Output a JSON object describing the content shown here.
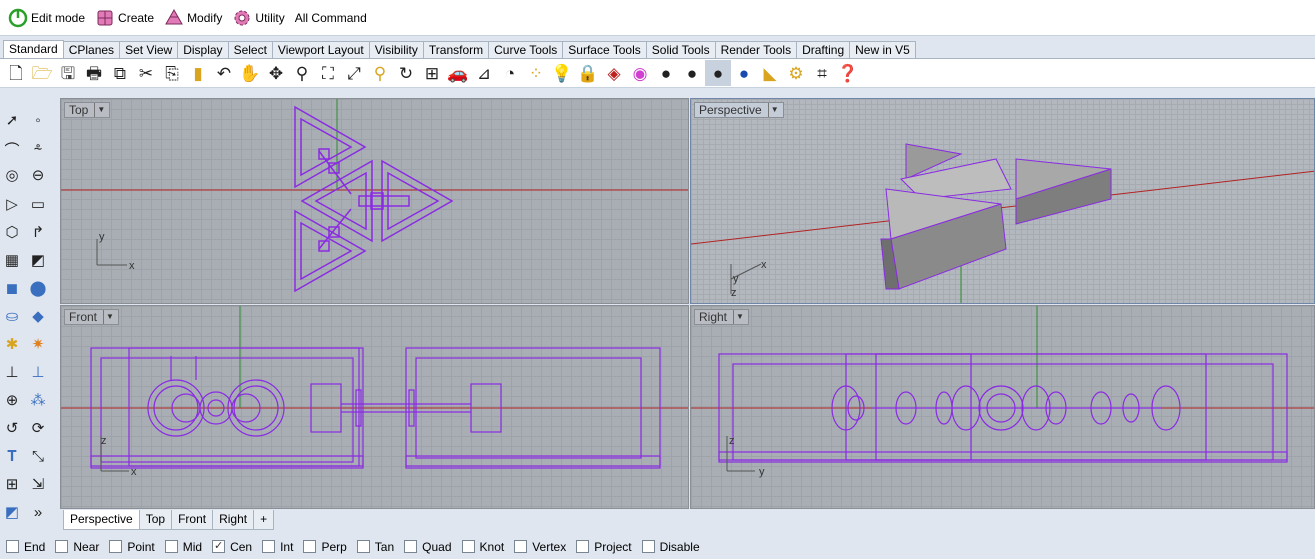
{
  "toolbar": {
    "edit_mode": "Edit mode",
    "create": "Create",
    "modify": "Modify",
    "utility": "Utility",
    "all_command": "All Command"
  },
  "tabs": [
    "Standard",
    "CPlanes",
    "Set View",
    "Display",
    "Select",
    "Viewport Layout",
    "Visibility",
    "Transform",
    "Curve Tools",
    "Surface Tools",
    "Solid Tools",
    "Render Tools",
    "Drafting",
    "New in V5"
  ],
  "active_tab": "Standard",
  "viewports": {
    "top": {
      "label": "Top",
      "x_axis": "x",
      "y_axis": "y"
    },
    "perspective": {
      "label": "Perspective",
      "x_axis": "x",
      "y_axis": "y",
      "z_axis": "z"
    },
    "front": {
      "label": "Front",
      "x_axis": "x",
      "z_axis": "z"
    },
    "right": {
      "label": "Right",
      "y_axis": "y",
      "z_axis": "z"
    }
  },
  "viewport_tabs": [
    "Perspective",
    "Top",
    "Front",
    "Right",
    "+"
  ],
  "osnaps": [
    {
      "label": "End",
      "checked": false
    },
    {
      "label": "Near",
      "checked": false
    },
    {
      "label": "Point",
      "checked": false
    },
    {
      "label": "Mid",
      "checked": false
    },
    {
      "label": "Cen",
      "checked": true
    },
    {
      "label": "Int",
      "checked": false
    },
    {
      "label": "Perp",
      "checked": false
    },
    {
      "label": "Tan",
      "checked": false
    },
    {
      "label": "Quad",
      "checked": false
    },
    {
      "label": "Knot",
      "checked": false
    },
    {
      "label": "Vertex",
      "checked": false
    },
    {
      "label": "Project",
      "checked": false
    },
    {
      "label": "Disable",
      "checked": false
    }
  ],
  "colors": {
    "curve": "#8a2be2",
    "axis_x": "#b22222",
    "axis_y": "#2e8b2e",
    "active_label": "#c4ccd8"
  }
}
